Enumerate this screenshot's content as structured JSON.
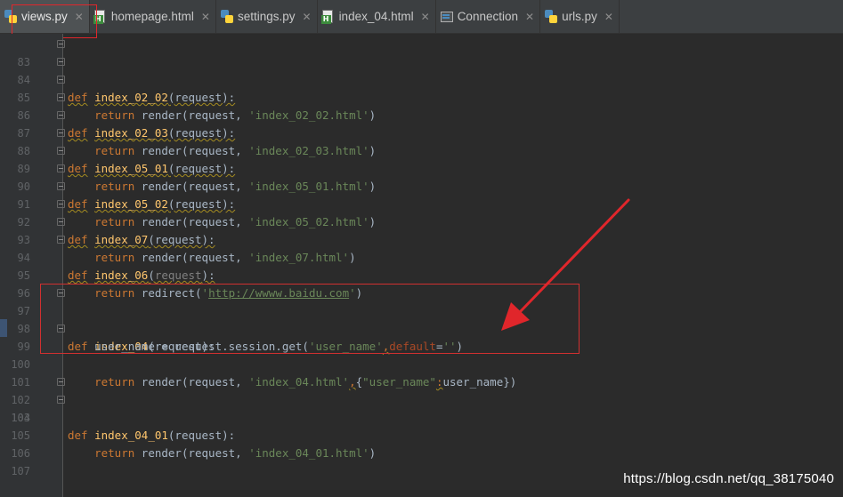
{
  "tabs": [
    {
      "label": "views.py",
      "icon": "python-file-icon",
      "active": true
    },
    {
      "label": "homepage.html",
      "icon": "html-file-icon"
    },
    {
      "label": "settings.py",
      "icon": "python-file-icon"
    },
    {
      "label": "index_04.html",
      "icon": "html-file-icon"
    },
    {
      "label": "Connection",
      "icon": "connection-icon"
    },
    {
      "label": "urls.py",
      "icon": "python-file-icon"
    }
  ],
  "close_glyph": "✕",
  "code": {
    "l83": {
      "n": "83",
      "kw": "def",
      "fn": "index_02_02",
      "rest": "(request):"
    },
    "l84": {
      "n": "84",
      "ret": "return",
      "mid": " render(request, ",
      "str": "'index_02_02.html'",
      "end": ")"
    },
    "l85": {
      "n": "85",
      "kw": "def",
      "fn": "index_02_03",
      "rest": "(request):"
    },
    "l86": {
      "n": "86",
      "ret": "return",
      "mid": " render(request, ",
      "str": "'index_02_03.html'",
      "end": ")"
    },
    "l87": {
      "n": "87",
      "kw": "def",
      "fn": "index_05_01",
      "rest": "(request):"
    },
    "l88": {
      "n": "88",
      "ret": "return",
      "mid": " render(request, ",
      "str": "'index_05_01.html'",
      "end": ")"
    },
    "l89": {
      "n": "89",
      "kw": "def",
      "fn": "index_05_02",
      "rest": "(request):"
    },
    "l90": {
      "n": "90",
      "ret": "return",
      "mid": " render(request, ",
      "str": "'index_05_02.html'",
      "end": ")"
    },
    "l91": {
      "n": "91",
      "kw": "def",
      "fn": "index_07",
      "rest": "(request):"
    },
    "l92": {
      "n": "92",
      "ret": "return",
      "mid": " render(request, ",
      "str": "'index_07.html'",
      "end": ")"
    },
    "l93": {
      "n": "93",
      "kw": "def",
      "fn": "index_06",
      "paren": "(",
      "arg": "request",
      "rest": "):"
    },
    "l94": {
      "n": "94",
      "ret": "return",
      "mid": " redirect(",
      "q1": "'",
      "url": "http://wwww.baidu.com",
      "q2": "'",
      "end": ")"
    },
    "l95": {
      "n": "95"
    },
    "l96": {
      "n": "96"
    },
    "l97": {
      "n": "97",
      "kw": "def",
      "fn": "index_04",
      "rest": "(request):"
    },
    "l98": {
      "n": "98",
      "pre": "user_name = request.session.get(",
      "str": "'user_name'",
      "comma": ",",
      "param": "default",
      "eq": "=",
      "str2": "''",
      "end": ")"
    },
    "l99": {
      "n": "99",
      "ret": "return",
      "mid": " render(request, ",
      "str": "'index_04.html'",
      "comma": ",",
      "brace": "{",
      "str2": "\"user_name\"",
      "colon": ":",
      "end": "user_name})"
    },
    "l100": {
      "n": "100"
    },
    "l101": {
      "n": "101"
    },
    "l102": {
      "n": "102",
      "kw": "def",
      "fn": "index_04_01",
      "rest": "(request):"
    },
    "l103": {
      "n": "103",
      "ret": "return",
      "mid": " render(request, ",
      "str": "'index_04_01.html'",
      "end": ")"
    },
    "l104": {
      "n": "104"
    },
    "l105": {
      "n": "105"
    },
    "l106": {
      "n": "106"
    },
    "l107": {
      "n": "107"
    }
  },
  "watermark": "https://blog.csdn.net/qq_38175040",
  "colors": {
    "annotation": "#e0262b",
    "background": "#2b2b2b",
    "keyword": "#cc7832",
    "string": "#6a8759",
    "function": "#ffc66d"
  }
}
